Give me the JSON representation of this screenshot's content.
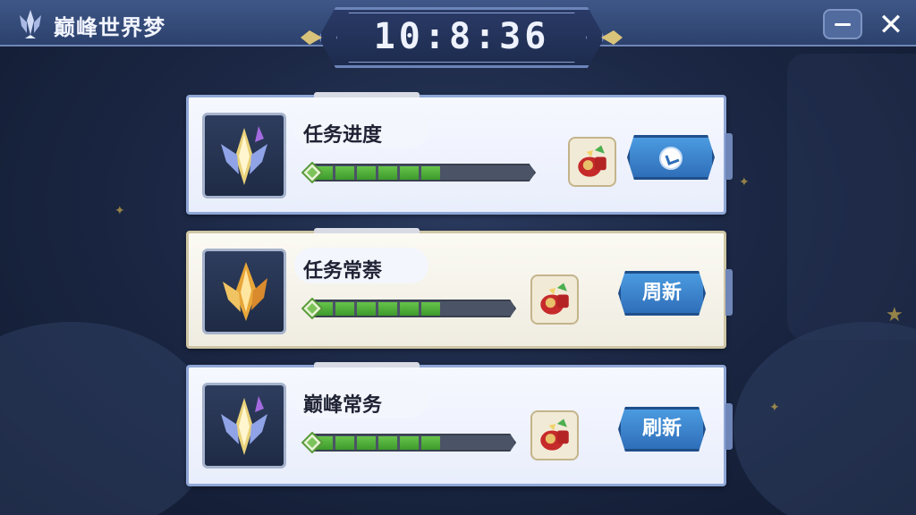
{
  "app": {
    "title": "巅峰世界梦",
    "logo_icon": "crystal-crown-icon",
    "minimize_icon": "minimize-icon",
    "close_icon": "close-icon",
    "close_glyph": "✕"
  },
  "timer": {
    "value": "10:8:36"
  },
  "cards": [
    {
      "label": "任务进度",
      "icon": "crystal-crest-icon",
      "progress_segments_filled": 6,
      "reward_icon": "red-gift-pouch-icon",
      "button": {
        "label": "",
        "icon": "refresh-spin-icon"
      }
    },
    {
      "label": "任务常萘",
      "icon": "golden-crest-icon",
      "progress_segments_filled": 6,
      "reward_icon": "red-gift-pouch-icon",
      "button": {
        "label": "周新"
      }
    },
    {
      "label": "巅峰常务",
      "icon": "crystal-crest-icon",
      "progress_segments_filled": 6,
      "reward_icon": "red-gift-pouch-icon",
      "button": {
        "label": "刷新"
      }
    }
  ],
  "colors": {
    "topbar": "#2c416c",
    "progress_fill": "#3d9a2c",
    "button": "#2f6fb9"
  }
}
